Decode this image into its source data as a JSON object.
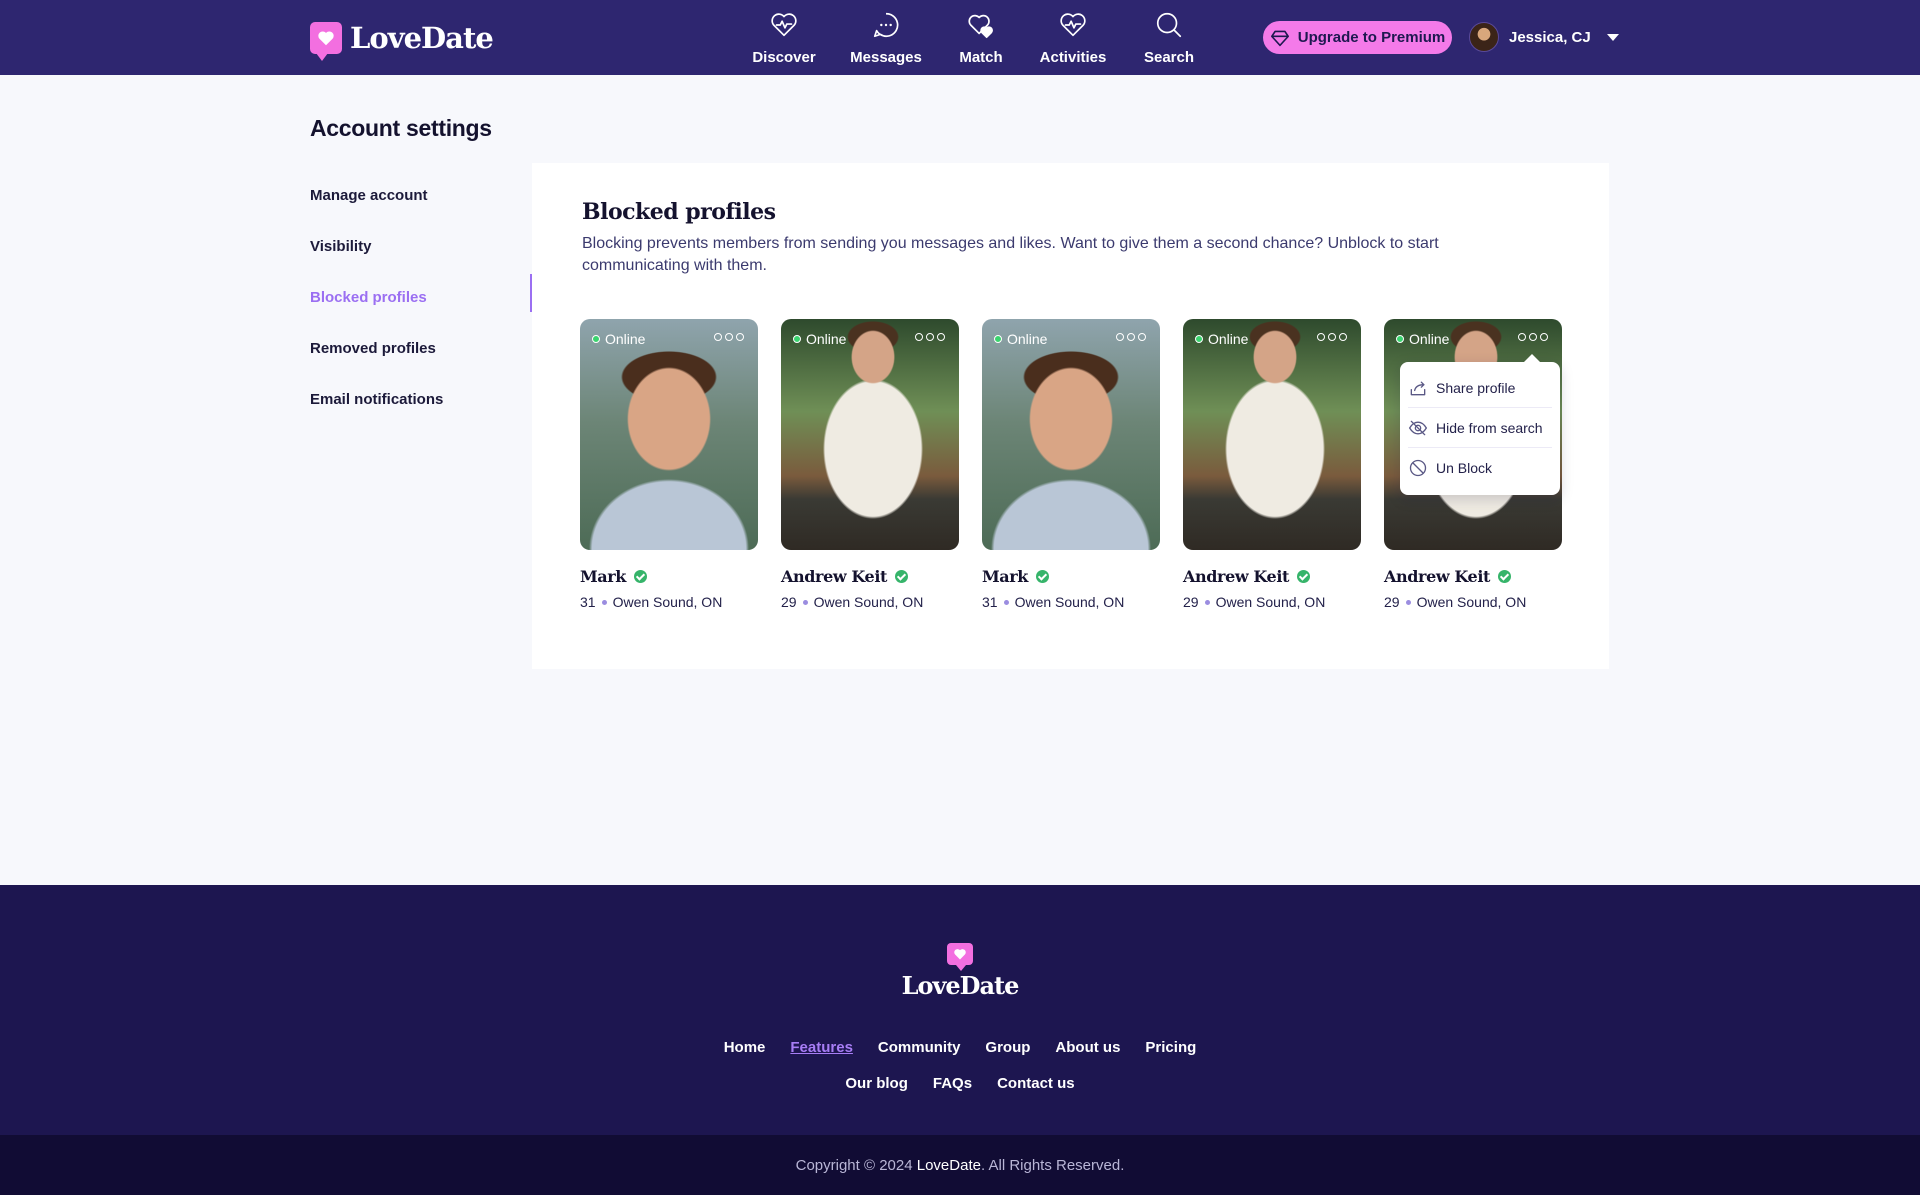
{
  "header": {
    "logo": "LoveDate",
    "nav": [
      {
        "label": "Discover",
        "icon": "heart-pulse-icon"
      },
      {
        "label": "Messages",
        "icon": "chat-bubble-icon"
      },
      {
        "label": "Match",
        "icon": "hearts-icon"
      },
      {
        "label": "Activities",
        "icon": "heart-pulse-icon"
      },
      {
        "label": "Search",
        "icon": "search-icon"
      }
    ],
    "premium_label": "Upgrade to Premium",
    "user_name": "Jessica, CJ"
  },
  "sidebar": {
    "title": "Account settings",
    "items": [
      {
        "label": "Manage account"
      },
      {
        "label": "Visibility"
      },
      {
        "label": "Blocked profiles",
        "active": true
      },
      {
        "label": "Removed profiles"
      },
      {
        "label": "Email notifications"
      }
    ]
  },
  "main": {
    "title": "Blocked profiles",
    "description": "Blocking prevents members from sending you messages and likes. Want to give them a second chance? Unblock to start communicating with them.",
    "profiles": [
      {
        "status": "Online",
        "name": "Mark",
        "age": "31",
        "location": "Owen Sound, ON"
      },
      {
        "status": "Online",
        "name": "Andrew Keit",
        "age": "29",
        "location": "Owen Sound, ON"
      },
      {
        "status": "Online",
        "name": "Mark",
        "age": "31",
        "location": "Owen Sound, ON"
      },
      {
        "status": "Online",
        "name": "Andrew Keit",
        "age": "29",
        "location": "Owen Sound, ON"
      },
      {
        "status": "Online",
        "name": "Andrew Keit",
        "age": "29",
        "location": "Owen Sound, ON"
      }
    ],
    "dropdown": {
      "items": [
        {
          "label": "Share profile",
          "icon": "share-icon"
        },
        {
          "label": "Hide from search",
          "icon": "eye-off-icon"
        },
        {
          "label": "Un Block",
          "icon": "block-icon"
        }
      ]
    }
  },
  "footer": {
    "logo": "LoveDate",
    "links_row1": [
      "Home",
      "Features",
      "Community",
      "Group",
      "About us",
      "Pricing"
    ],
    "links_row2": [
      "Our blog",
      "FAQs",
      "Contact us"
    ],
    "copyright_prefix": "Copyright © 2024 ",
    "copyright_brand": "LoveDate",
    "copyright_suffix": ". All Rights Reserved."
  },
  "colors": {
    "header_bg": "#2e2670",
    "accent": "#9b6ff2",
    "premium": "#f47ae9",
    "footer_bg": "#1d1650",
    "verified": "#36b46a"
  }
}
